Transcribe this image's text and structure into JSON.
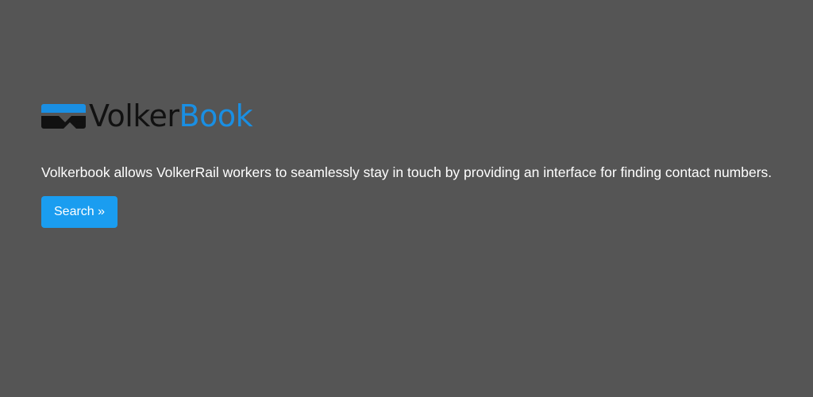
{
  "logo": {
    "part1": "Volker",
    "part2": "Book",
    "colors": {
      "part1": "#111111",
      "part2": "#1a8fe3"
    },
    "icon": "volkerbook-logo-mark"
  },
  "hero": {
    "description": "Volkerbook allows VolkerRail workers to seamlessly stay in touch by providing an interface for finding contact numbers.",
    "search_label": "Search »"
  },
  "colors": {
    "background": "#555555",
    "accent": "#1a9df0",
    "text": "#ffffff"
  }
}
